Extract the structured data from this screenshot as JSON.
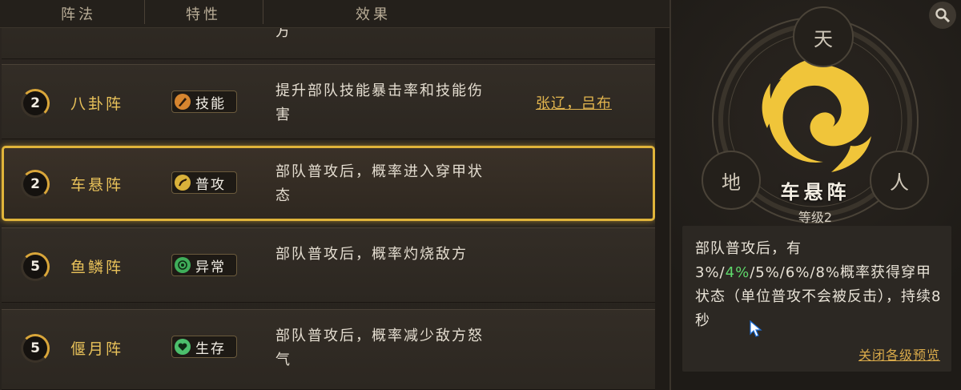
{
  "columns": {
    "formation": "阵法",
    "trait": "特性",
    "effect": "效果"
  },
  "partial_row": {
    "effect_tail": "方"
  },
  "rows": [
    {
      "level": "2",
      "name": "八卦阵",
      "trait": "技能",
      "trait_color": "#d6852f",
      "effect": "提升部队技能暴击率和技能伤害",
      "heroes": "张辽，吕布",
      "selected": false
    },
    {
      "level": "2",
      "name": "车悬阵",
      "trait": "普攻",
      "trait_color": "#d9b13a",
      "effect": "部队普攻后，概率进入穿甲状态",
      "heroes": "",
      "selected": true
    },
    {
      "level": "5",
      "name": "鱼鳞阵",
      "trait": "异常",
      "trait_color": "#3fae5a",
      "effect": "部队普攻后，概率灼烧敌方",
      "heroes": "",
      "selected": false
    },
    {
      "level": "5",
      "name": "偃月阵",
      "trait": "生存",
      "trait_color": "#4cbf6c",
      "effect": "部队普攻后，概率减少敌方怒气",
      "heroes": "",
      "selected": false
    }
  ],
  "detail": {
    "emblem_labels": {
      "top": "天",
      "left": "地",
      "right": "人"
    },
    "title": "车悬阵",
    "level_text": "等级2",
    "desc_before": "部队普攻后，有3%/",
    "desc_highlight": "4%",
    "desc_after": "/5%/6%/8%概率获得穿甲状态（单位普攻不会被反击），持续8秒",
    "highlight_color": "#5fd86b",
    "close_preview": "关闭各级预览"
  },
  "colors": {
    "accent_gold": "#e0b43a",
    "name_gold": "#e9c25a"
  }
}
